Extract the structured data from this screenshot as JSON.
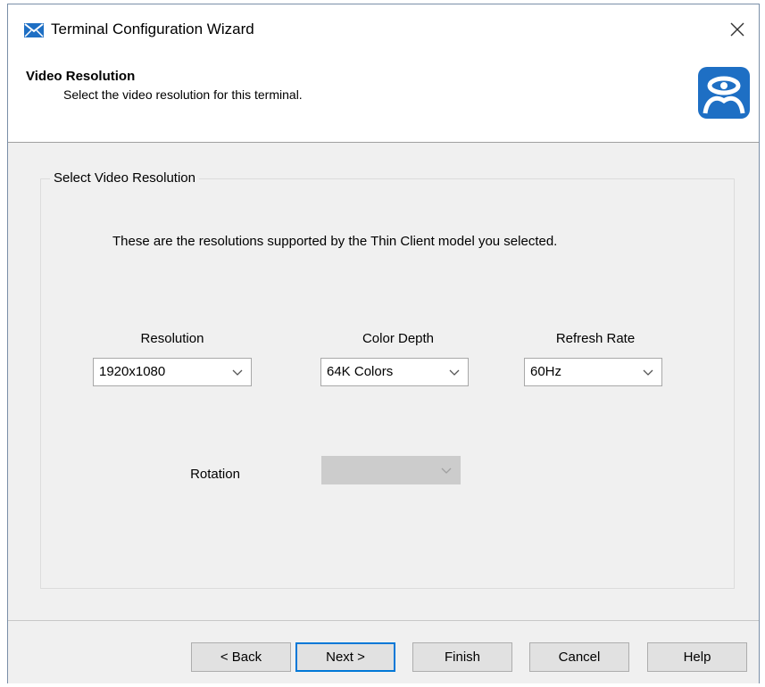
{
  "window": {
    "title": "Terminal Configuration Wizard",
    "icons": {
      "app": "wizard-envelope-icon",
      "close": "close-icon",
      "logo": "thinmanager-logo-icon"
    }
  },
  "header": {
    "title": "Video Resolution",
    "subtitle": "Select the video resolution for this terminal."
  },
  "group": {
    "legend": "Select Video Resolution",
    "info": "These are the resolutions supported by the Thin Client model you selected."
  },
  "fields": {
    "resolution": {
      "label": "Resolution",
      "value": "1920x1080"
    },
    "color_depth": {
      "label": "Color Depth",
      "value": "64K Colors"
    },
    "refresh_rate": {
      "label": "Refresh Rate",
      "value": "60Hz"
    },
    "rotation": {
      "label": "Rotation",
      "value": "",
      "enabled": false
    }
  },
  "buttons": {
    "back": "< Back",
    "next": "Next >",
    "finish": "Finish",
    "cancel": "Cancel",
    "help": "Help"
  },
  "colors": {
    "accent": "#0078d7",
    "logo_blue": "#1e6fc4",
    "panel": "#f0f0f0"
  }
}
